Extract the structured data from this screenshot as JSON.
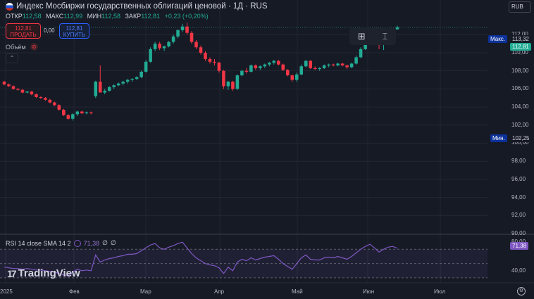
{
  "header": {
    "title": "Индекс Мосбиржи государственных облигаций ценовой · 1Д · RUS",
    "ohlc": [
      {
        "label": "ОТКР",
        "value": "112,58"
      },
      {
        "label": "МАКС",
        "value": "112,99"
      },
      {
        "label": "МИН",
        "value": "112,58"
      },
      {
        "label": "ЗАКР",
        "value": "112,81"
      }
    ],
    "change": "+0,23 (+0,20%)"
  },
  "trade": {
    "sell_price": "112,81",
    "sell_label": "ПРОДАТЬ",
    "spread": "0,00",
    "buy_price": "112,81",
    "buy_label": "КУПИТЬ"
  },
  "volume_label": "Объём",
  "currency": "RUB",
  "colors": {
    "up": "#22ab94",
    "down": "#f23645",
    "bg": "#161a25",
    "rsi": "#7e57c2",
    "grid": "#232734"
  },
  "price_axis": {
    "ticks": [
      "112,00",
      "110,00",
      "108,00",
      "106,00",
      "104,00",
      "102,00",
      "100,00",
      "98,00",
      "96,00",
      "94,00",
      "92,00",
      "90,00",
      "80,00",
      "40,00"
    ],
    "max_label": "Макс.",
    "max_value": "113,32",
    "current": "112,81",
    "min_label": "Мин.",
    "min_value": "102,25"
  },
  "time_axis": [
    "2025",
    "Фев",
    "Мар",
    "Апр",
    "Май",
    "Июн",
    "Июл"
  ],
  "rsi": {
    "legend": "RSI 14 close SMA 14 2",
    "value": "71,38",
    "extra1": "∅",
    "extra2": "∅",
    "axis_label": "71,38"
  },
  "logo_text": "TradingView",
  "chart_data": {
    "type": "candlestick",
    "title": "Индекс Мосбиржи государственных облигаций ценовой",
    "ylim": [
      90,
      113.5
    ],
    "ohlc": [
      [
        106.8,
        106.9,
        106.4,
        106.5
      ],
      [
        106.5,
        106.6,
        106.2,
        106.3
      ],
      [
        106.3,
        106.4,
        105.9,
        106.0
      ],
      [
        106.0,
        106.1,
        105.8,
        105.9
      ],
      [
        105.9,
        106.0,
        105.5,
        105.6
      ],
      [
        105.6,
        105.8,
        105.5,
        105.7
      ],
      [
        105.7,
        105.8,
        105.3,
        105.4
      ],
      [
        105.4,
        105.5,
        105.0,
        105.1
      ],
      [
        105.1,
        105.2,
        104.9,
        105.0
      ],
      [
        105.0,
        105.1,
        104.7,
        104.8
      ],
      [
        104.8,
        104.9,
        104.4,
        104.5
      ],
      [
        104.5,
        104.6,
        104.1,
        104.2
      ],
      [
        104.2,
        104.3,
        103.6,
        103.7
      ],
      [
        103.7,
        103.8,
        103.0,
        103.1
      ],
      [
        103.1,
        103.2,
        102.6,
        102.7
      ],
      [
        102.7,
        103.3,
        102.5,
        103.2
      ],
      [
        103.2,
        103.6,
        103.0,
        103.5
      ],
      [
        103.5,
        103.6,
        103.2,
        103.3
      ],
      [
        103.3,
        103.5,
        103.2,
        103.4
      ],
      [
        103.4,
        103.5,
        103.2,
        103.3
      ],
      [
        105.2,
        106.9,
        105.0,
        106.8
      ],
      [
        106.8,
        108.6,
        106.3,
        105.6
      ],
      [
        105.6,
        106.0,
        105.4,
        105.8
      ],
      [
        105.8,
        106.3,
        105.7,
        106.2
      ],
      [
        106.2,
        106.5,
        106.0,
        106.4
      ],
      [
        106.4,
        106.7,
        106.3,
        106.6
      ],
      [
        106.6,
        106.9,
        106.4,
        106.8
      ],
      [
        106.8,
        107.1,
        106.6,
        107.0
      ],
      [
        107.0,
        107.2,
        106.8,
        107.1
      ],
      [
        107.1,
        107.4,
        107.0,
        107.3
      ],
      [
        107.3,
        108.0,
        107.2,
        107.9
      ],
      [
        107.9,
        109.2,
        107.8,
        109.0
      ],
      [
        109.0,
        110.6,
        108.9,
        110.4
      ],
      [
        110.4,
        111.2,
        110.2,
        111.0
      ],
      [
        111.0,
        111.2,
        110.3,
        110.5
      ],
      [
        110.5,
        110.8,
        110.2,
        110.7
      ],
      [
        110.7,
        111.3,
        110.6,
        111.2
      ],
      [
        111.2,
        112.0,
        111.0,
        111.8
      ],
      [
        111.8,
        112.6,
        111.6,
        112.5
      ],
      [
        112.5,
        113.2,
        112.3,
        112.9
      ],
      [
        112.9,
        113.3,
        112.0,
        112.2
      ],
      [
        112.2,
        112.4,
        111.0,
        111.2
      ],
      [
        111.2,
        111.4,
        110.4,
        110.6
      ],
      [
        110.6,
        110.8,
        109.8,
        110.0
      ],
      [
        110.0,
        110.2,
        109.1,
        109.3
      ],
      [
        109.3,
        109.5,
        108.8,
        109.0
      ],
      [
        109.0,
        109.3,
        108.6,
        108.9
      ],
      [
        108.9,
        109.0,
        107.8,
        108.0
      ],
      [
        108.0,
        108.1,
        106.0,
        106.3
      ],
      [
        106.3,
        106.9,
        105.9,
        106.8
      ],
      [
        106.8,
        106.9,
        105.8,
        106.0
      ],
      [
        106.0,
        107.6,
        105.9,
        107.5
      ],
      [
        107.5,
        108.1,
        107.4,
        108.0
      ],
      [
        108.0,
        108.3,
        107.7,
        107.9
      ],
      [
        107.9,
        108.7,
        107.8,
        108.6
      ],
      [
        108.6,
        108.7,
        108.1,
        108.3
      ],
      [
        108.3,
        108.6,
        108.1,
        108.5
      ],
      [
        108.5,
        108.8,
        108.3,
        108.7
      ],
      [
        108.7,
        109.0,
        108.5,
        108.9
      ],
      [
        108.9,
        109.2,
        108.7,
        109.1
      ],
      [
        109.1,
        109.2,
        108.6,
        108.7
      ],
      [
        108.7,
        108.8,
        108.0,
        108.1
      ],
      [
        108.1,
        108.2,
        107.4,
        107.5
      ],
      [
        107.5,
        107.6,
        106.8,
        107.0
      ],
      [
        107.0,
        107.8,
        106.8,
        107.6
      ],
      [
        107.6,
        108.7,
        107.5,
        108.5
      ],
      [
        108.5,
        109.2,
        108.4,
        109.1
      ],
      [
        109.1,
        109.2,
        108.2,
        108.3
      ],
      [
        108.3,
        108.5,
        108.1,
        108.2
      ],
      [
        108.2,
        108.4,
        108.0,
        108.3
      ],
      [
        108.3,
        108.7,
        108.2,
        108.6
      ],
      [
        108.6,
        108.8,
        108.4,
        108.7
      ],
      [
        108.7,
        108.8,
        108.5,
        108.6
      ],
      [
        108.6,
        108.9,
        108.5,
        108.8
      ],
      [
        108.8,
        108.9,
        108.5,
        108.6
      ],
      [
        108.6,
        108.7,
        108.2,
        108.4
      ],
      [
        108.4,
        108.9,
        108.3,
        108.8
      ],
      [
        108.8,
        109.7,
        108.7,
        109.5
      ],
      [
        109.5,
        110.6,
        109.4,
        110.4
      ],
      [
        110.4,
        111.6,
        110.3,
        111.4
      ],
      [
        111.4,
        112.6,
        111.3,
        112.4
      ],
      [
        112.4,
        112.6,
        111.7,
        111.9
      ],
      [
        111.9,
        112.2,
        110.4,
        111.0
      ],
      [
        111.0,
        111.6,
        110.3,
        111.4
      ],
      [
        111.4,
        112.3,
        111.3,
        112.1
      ],
      [
        112.1,
        112.6,
        111.9,
        112.4
      ],
      [
        112.58,
        112.99,
        112.58,
        112.81
      ]
    ],
    "rsi": [
      45,
      44,
      43,
      43,
      42,
      43,
      42,
      41,
      41,
      40,
      39,
      38,
      36,
      34,
      33,
      38,
      42,
      40,
      41,
      40,
      62,
      52,
      55,
      57,
      58,
      60,
      61,
      63,
      63,
      64,
      68,
      72,
      76,
      78,
      72,
      70,
      73,
      75,
      78,
      80,
      72,
      64,
      58,
      54,
      50,
      48,
      47,
      44,
      36,
      45,
      40,
      52,
      56,
      54,
      58,
      55,
      57,
      59,
      60,
      61,
      56,
      50,
      46,
      42,
      50,
      58,
      62,
      56,
      55,
      55,
      58,
      59,
      58,
      60,
      58,
      56,
      60,
      65,
      70,
      74,
      77,
      72,
      66,
      70,
      73,
      74,
      71.38
    ],
    "rsi_ylim": [
      25,
      90
    ],
    "rsi_levels": [
      70,
      50,
      30
    ]
  }
}
